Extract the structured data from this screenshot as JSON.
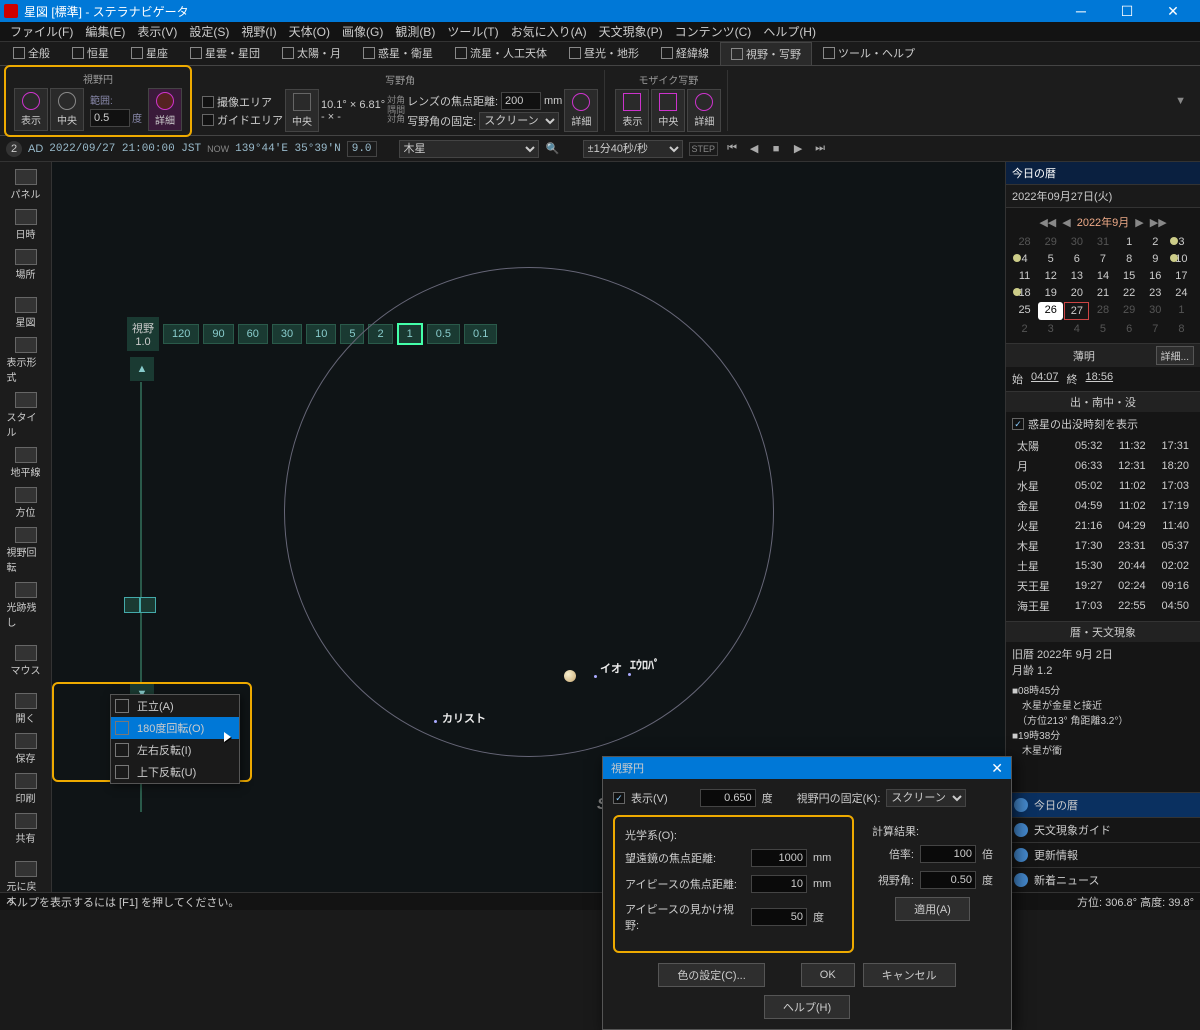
{
  "titlebar": {
    "title": "星図 [標準] - ステラナビゲータ"
  },
  "menubar": [
    "ファイル(F)",
    "編集(E)",
    "表示(V)",
    "設定(S)",
    "視野(I)",
    "天体(O)",
    "画像(G)",
    "観測(B)",
    "ツール(T)",
    "お気に入り(A)",
    "天文現象(P)",
    "コンテンツ(C)",
    "ヘルプ(H)"
  ],
  "ribbon_tabs": [
    {
      "icon": "globe",
      "label": "全般"
    },
    {
      "icon": "star",
      "label": "恒星"
    },
    {
      "icon": "const",
      "label": "星座"
    },
    {
      "icon": "neb",
      "label": "星雲・星団"
    },
    {
      "icon": "sun",
      "label": "太陽・月"
    },
    {
      "icon": "planet",
      "label": "惑星・衛星"
    },
    {
      "icon": "comet",
      "label": "流星・人工天体"
    },
    {
      "icon": "geo",
      "label": "昼光・地形"
    },
    {
      "icon": "grid",
      "label": "経緯線"
    },
    {
      "icon": "fov",
      "label": "視野・写野",
      "active": true
    },
    {
      "icon": "tool",
      "label": "ツール・ヘルプ"
    }
  ],
  "ribbon": {
    "fov_group": {
      "title": "視野円",
      "show": "表示",
      "center": "中央",
      "detail": "詳細",
      "range_label": "範囲:",
      "range_value": "0.5",
      "range_unit": "度"
    },
    "capture_group": {
      "title": "写野角",
      "cap_area": "撮像エリア",
      "guide_area": "ガイドエリア",
      "center": "中央",
      "detail": "詳細",
      "size": "10.1° ×  6.81°",
      "diag": "対角\n隅間\n対角",
      "diag2": "- ×  -",
      "lens_fl": "レンズの焦点距離:",
      "lens_val": "200",
      "lens_unit": "mm",
      "lock": "写野角の固定:",
      "lock_val": "スクリーン"
    },
    "mosaic": {
      "title": "モザイク写野",
      "show": "表示",
      "center": "中央",
      "detail": "詳細"
    }
  },
  "infobar": {
    "era": "AD",
    "datetime": "2022/09/27 21:00:00 JST",
    "now": "NOW",
    "coords": "139°44'E 35°39'N",
    "zoom": "9.0",
    "target": "木星",
    "interval": "±1分40秒/秒"
  },
  "left_sidebar": [
    "パネル",
    "日時",
    "場所",
    "",
    "星図",
    "表示形式",
    "スタイル",
    "地平線",
    "方位",
    "視野回転",
    "光跡残し",
    "",
    "マウス",
    "",
    "開く",
    "保存",
    "印刷",
    "共有",
    "",
    "元に戻す"
  ],
  "fov_scale": {
    "label": "視野",
    "cur": "1.0",
    "buttons": [
      "120",
      "90",
      "60",
      "30",
      "10",
      "5",
      "2",
      "1",
      "0.5",
      "0.1"
    ],
    "selected": "1"
  },
  "sky": {
    "objects": {
      "jupiter": "",
      "io": "イオ",
      "europa": "エウロパ",
      "callisto": "カリスト"
    },
    "watermark": "StellaNavigator / AstroArts"
  },
  "context_menu": [
    "正立(A)",
    "180度回転(O)",
    "左右反転(I)",
    "上下反転(U)"
  ],
  "dialog": {
    "title": "視野円",
    "show": "表示(V)",
    "range": "0.650",
    "range_unit": "度",
    "lock_label": "視野円の固定(K):",
    "lock_value": "スクリーン",
    "optics_title": "光学系(O):",
    "tele_fl": "望遠鏡の焦点距離:",
    "tele_val": "1000",
    "tele_unit": "mm",
    "ep_fl": "アイピースの焦点距離:",
    "ep_val": "10",
    "ep_unit": "mm",
    "ep_afov": "アイピースの見かけ視野:",
    "afov_val": "50",
    "afov_unit": "度",
    "calc_title": "計算結果:",
    "mag_label": "倍率:",
    "mag_val": "100",
    "mag_unit": "倍",
    "fov_label": "視野角:",
    "fov_val": "0.50",
    "fov_unit": "度",
    "apply": "適用(A)",
    "color_btn": "色の設定(C)...",
    "ok": "OK",
    "cancel": "キャンセル",
    "help": "ヘルプ(H)"
  },
  "right_panel": {
    "header": "今日の暦",
    "date": "2022年09月27日(火)",
    "cal_month": "2022年9月",
    "cal_days": [
      {
        "d": 28,
        "dim": true
      },
      {
        "d": 29,
        "dim": true
      },
      {
        "d": 30,
        "dim": true
      },
      {
        "d": 31,
        "dim": true
      },
      {
        "d": 1
      },
      {
        "d": 2
      },
      {
        "d": 3,
        "moon": true
      },
      {
        "d": 4,
        "moon": true
      },
      {
        "d": 5
      },
      {
        "d": 6
      },
      {
        "d": 7
      },
      {
        "d": 8
      },
      {
        "d": 9
      },
      {
        "d": 10,
        "moon": true
      },
      {
        "d": 11
      },
      {
        "d": 12
      },
      {
        "d": 13
      },
      {
        "d": 14
      },
      {
        "d": 15
      },
      {
        "d": 16
      },
      {
        "d": 17
      },
      {
        "d": 18,
        "moon": true
      },
      {
        "d": 19
      },
      {
        "d": 20
      },
      {
        "d": 21
      },
      {
        "d": 22
      },
      {
        "d": 23
      },
      {
        "d": 24
      },
      {
        "d": 25
      },
      {
        "d": 26,
        "sel": true
      },
      {
        "d": 27,
        "today": true
      },
      {
        "d": 28,
        "dim": true
      },
      {
        "d": 29,
        "dim": true
      },
      {
        "d": 30,
        "dim": true
      },
      {
        "d": 1,
        "dim": true
      },
      {
        "d": 2,
        "dim": true
      },
      {
        "d": 3,
        "dim": true
      },
      {
        "d": 4,
        "dim": true
      },
      {
        "d": 5,
        "dim": true
      },
      {
        "d": 6,
        "dim": true
      },
      {
        "d": 7,
        "dim": true
      },
      {
        "d": 8,
        "dim": true
      }
    ],
    "twilight": {
      "title": "薄明",
      "begin_lbl": "始",
      "begin": "04:07",
      "end_lbl": "終",
      "end": "18:56",
      "detail": "詳細..."
    },
    "rise": {
      "title": "出・南中・没",
      "show": "惑星の出没時刻を表示",
      "rows": [
        {
          "n": "太陽",
          "r": "05:32",
          "t": "11:32",
          "s": "17:31"
        },
        {
          "n": "月",
          "r": "06:33",
          "t": "12:31",
          "s": "18:20"
        },
        {
          "n": "水星",
          "r": "05:02",
          "t": "11:02",
          "s": "17:03"
        },
        {
          "n": "金星",
          "r": "04:59",
          "t": "11:02",
          "s": "17:19"
        },
        {
          "n": "火星",
          "r": "21:16",
          "t": "04:29",
          "s": "11:40"
        },
        {
          "n": "木星",
          "r": "17:30",
          "t": "23:31",
          "s": "05:37"
        },
        {
          "n": "土星",
          "r": "15:30",
          "t": "20:44",
          "s": "02:02"
        },
        {
          "n": "天王星",
          "r": "19:27",
          "t": "02:24",
          "s": "09:16"
        },
        {
          "n": "海王星",
          "r": "17:03",
          "t": "22:55",
          "s": "04:50"
        }
      ]
    },
    "events": {
      "title": "暦・天文現象",
      "lunar": "旧暦 2022年 9月 2日",
      "moon_age": "月齢 1.2",
      "items": [
        "■08時45分",
        "　水星が金星と接近",
        "　（方位213° 角距離3.2°）",
        "■19時38分",
        "　木星が衝"
      ]
    },
    "tabs": [
      "今日の暦",
      "天文現象ガイド",
      "更新情報",
      "新着ニュース"
    ]
  },
  "statusbar": {
    "help": "ヘルプを表示するには [F1] を押してください。",
    "coords": "方位: 306.8° 高度: 39.8°"
  }
}
